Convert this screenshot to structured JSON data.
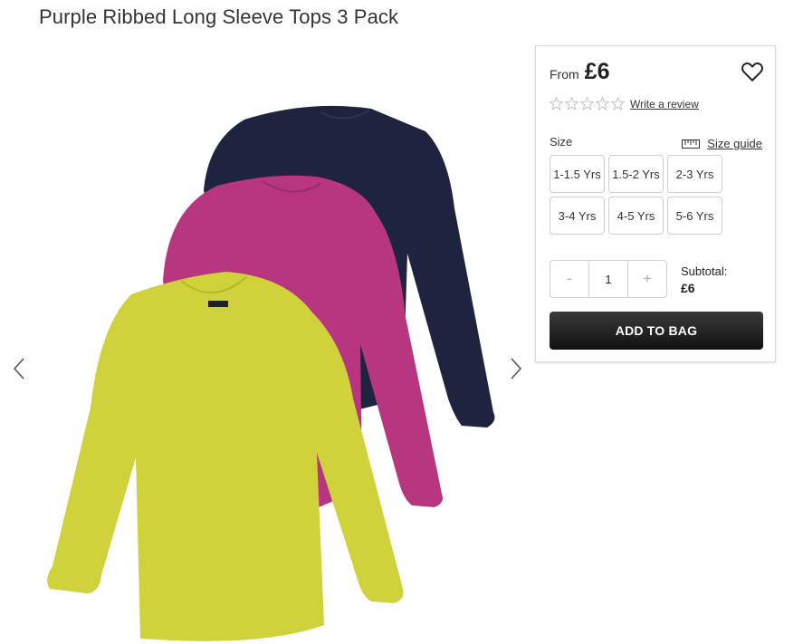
{
  "product": {
    "title": "Purple Ribbed Long Sleeve Tops 3 Pack",
    "image_alt": "three ribbed long sleeve tops: navy, pink, lime"
  },
  "gallery": {
    "prev_icon": "chevron-left-icon",
    "next_icon": "chevron-right-icon"
  },
  "panel": {
    "from_label": "From",
    "price": "£6",
    "wishlist_icon": "heart-icon",
    "review_link": "Write a review",
    "rating": 0,
    "rating_max": 5,
    "size_label": "Size",
    "size_guide_label": "Size guide",
    "sizes": [
      "1-1.5 Yrs",
      "1.5-2 Yrs",
      "2-3 Yrs",
      "3-4 Yrs",
      "4-5 Yrs",
      "5-6 Yrs"
    ],
    "quantity": {
      "minus": "-",
      "value": "1",
      "plus": "+"
    },
    "subtotal_label": "Subtotal:",
    "subtotal_value": "£6",
    "add_to_bag": "ADD TO BAG"
  },
  "colors": {
    "navy": "#1e2340",
    "pink": "#b8357f",
    "lime": "#cfd23a",
    "button": "#1a1a1a"
  }
}
